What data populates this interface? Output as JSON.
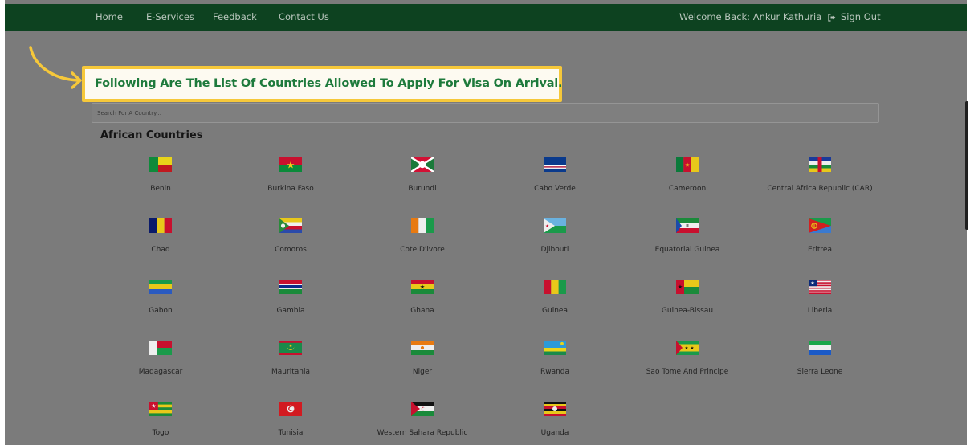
{
  "nav": {
    "home": "Home",
    "eservices": "E-Services",
    "feedback": "Feedback",
    "contact": "Contact Us",
    "welcome": "Welcome Back: Ankur Kathuria",
    "signout": "Sign Out"
  },
  "headline": "Following Are The List Of Countries Allowed To Apply For Visa On Arrival.",
  "search": {
    "placeholder": "Search For A Country..."
  },
  "section": {
    "title": "African Countries"
  },
  "countries": [
    {
      "name": "Benin",
      "flag": "benin-flag-icon"
    },
    {
      "name": "Burkina Faso",
      "flag": "burkina-faso-flag-icon"
    },
    {
      "name": "Burundi",
      "flag": "burundi-flag-icon"
    },
    {
      "name": "Cabo Verde",
      "flag": "cabo-verde-flag-icon"
    },
    {
      "name": "Cameroon",
      "flag": "cameroon-flag-icon"
    },
    {
      "name": "Central Africa Republic (CAR)",
      "flag": "car-flag-icon"
    },
    {
      "name": "Chad",
      "flag": "chad-flag-icon"
    },
    {
      "name": "Comoros",
      "flag": "comoros-flag-icon"
    },
    {
      "name": "Cote D'ivore",
      "flag": "cote-divoire-flag-icon"
    },
    {
      "name": "Djibouti",
      "flag": "djibouti-flag-icon"
    },
    {
      "name": "Equatorial Guinea",
      "flag": "equatorial-guinea-flag-icon"
    },
    {
      "name": "Eritrea",
      "flag": "eritrea-flag-icon"
    },
    {
      "name": "Gabon",
      "flag": "gabon-flag-icon"
    },
    {
      "name": "Gambia",
      "flag": "gambia-flag-icon"
    },
    {
      "name": "Ghana",
      "flag": "ghana-flag-icon"
    },
    {
      "name": "Guinea",
      "flag": "guinea-flag-icon"
    },
    {
      "name": "Guinea-Bissau",
      "flag": "guinea-bissau-flag-icon"
    },
    {
      "name": "Liberia",
      "flag": "liberia-flag-icon"
    },
    {
      "name": "Madagascar",
      "flag": "madagascar-flag-icon"
    },
    {
      "name": "Mauritania",
      "flag": "mauritania-flag-icon"
    },
    {
      "name": "Niger",
      "flag": "niger-flag-icon"
    },
    {
      "name": "Rwanda",
      "flag": "rwanda-flag-icon"
    },
    {
      "name": "Sao Tome And Principe",
      "flag": "sao-tome-flag-icon"
    },
    {
      "name": "Sierra Leone",
      "flag": "sierra-leone-flag-icon"
    },
    {
      "name": "Togo",
      "flag": "togo-flag-icon"
    },
    {
      "name": "Tunisia",
      "flag": "tunisia-flag-icon"
    },
    {
      "name": "Western Sahara Republic",
      "flag": "western-sahara-flag-icon"
    },
    {
      "name": "Uganda",
      "flag": "uganda-flag-icon"
    }
  ],
  "colors": {
    "navbar": "#0d4220",
    "headline_text": "#1e7a3c",
    "highlight_border": "#f6c83a",
    "overlay": "#7b7b7b"
  }
}
